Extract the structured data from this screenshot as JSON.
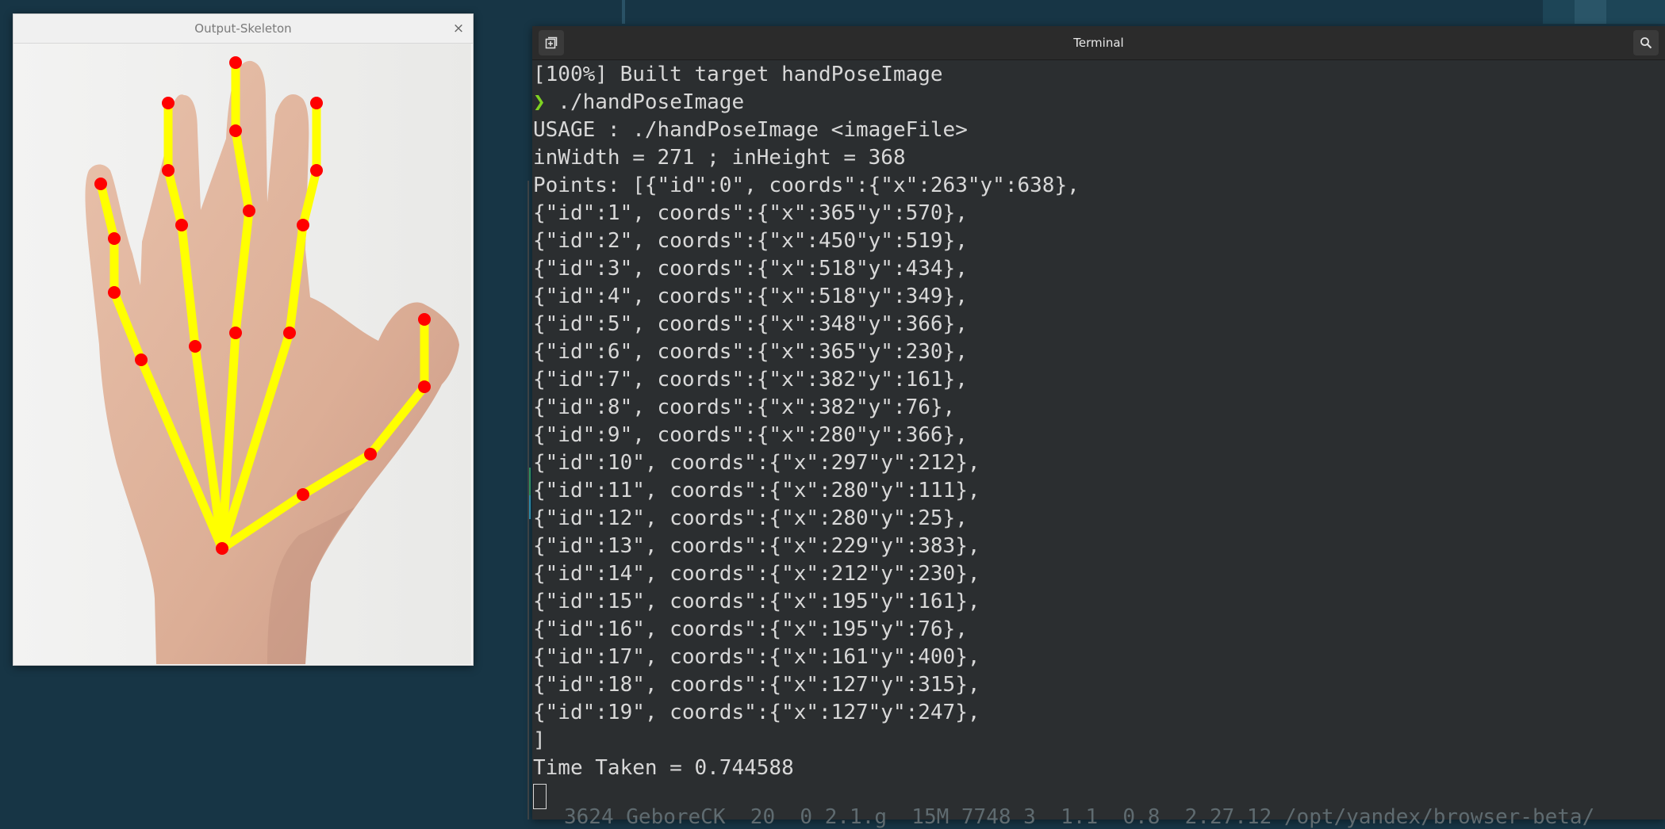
{
  "skeleton_window": {
    "title": "Output-Skeleton",
    "close_label": "×"
  },
  "terminal": {
    "title": "Terminal",
    "new_tab_icon": "new-tab-icon",
    "search_icon": "search-icon",
    "lines": [
      {
        "prompt": "",
        "text": "[100%] Built target handPoseImage"
      },
      {
        "prompt": "❯",
        "text": " ./handPoseImage"
      },
      {
        "prompt": "",
        "text": "USAGE : ./handPoseImage <imageFile>"
      },
      {
        "prompt": "",
        "text": "inWidth = 271 ; inHeight = 368"
      },
      {
        "prompt": "",
        "text": "Points: [{\"id\":0\", coords\":{\"x\":263\"y\":638},"
      },
      {
        "prompt": "",
        "text": "{\"id\":1\", coords\":{\"x\":365\"y\":570},"
      },
      {
        "prompt": "",
        "text": "{\"id\":2\", coords\":{\"x\":450\"y\":519},"
      },
      {
        "prompt": "",
        "text": "{\"id\":3\", coords\":{\"x\":518\"y\":434},"
      },
      {
        "prompt": "",
        "text": "{\"id\":4\", coords\":{\"x\":518\"y\":349},"
      },
      {
        "prompt": "",
        "text": "{\"id\":5\", coords\":{\"x\":348\"y\":366},"
      },
      {
        "prompt": "",
        "text": "{\"id\":6\", coords\":{\"x\":365\"y\":230},"
      },
      {
        "prompt": "",
        "text": "{\"id\":7\", coords\":{\"x\":382\"y\":161},"
      },
      {
        "prompt": "",
        "text": "{\"id\":8\", coords\":{\"x\":382\"y\":76},"
      },
      {
        "prompt": "",
        "text": "{\"id\":9\", coords\":{\"x\":280\"y\":366},"
      },
      {
        "prompt": "",
        "text": "{\"id\":10\", coords\":{\"x\":297\"y\":212},"
      },
      {
        "prompt": "",
        "text": "{\"id\":11\", coords\":{\"x\":280\"y\":111},"
      },
      {
        "prompt": "",
        "text": "{\"id\":12\", coords\":{\"x\":280\"y\":25},"
      },
      {
        "prompt": "",
        "text": "{\"id\":13\", coords\":{\"x\":229\"y\":383},"
      },
      {
        "prompt": "",
        "text": "{\"id\":14\", coords\":{\"x\":212\"y\":230},"
      },
      {
        "prompt": "",
        "text": "{\"id\":15\", coords\":{\"x\":195\"y\":161},"
      },
      {
        "prompt": "",
        "text": "{\"id\":16\", coords\":{\"x\":195\"y\":76},"
      },
      {
        "prompt": "",
        "text": "{\"id\":17\", coords\":{\"x\":161\"y\":400},"
      },
      {
        "prompt": "",
        "text": "{\"id\":18\", coords\":{\"x\":127\"y\":315},"
      },
      {
        "prompt": "",
        "text": "{\"id\":19\", coords\":{\"x\":127\"y\":247},"
      },
      {
        "prompt": "",
        "text": "]"
      },
      {
        "prompt": "",
        "text": "Time Taken = 0.744588"
      }
    ],
    "footer_text": "3624 GeboreCK  20  0 2.1.g  15M 7748 3  1.1  0.8  2.27.12 /opt/yandex/browser-beta/"
  },
  "colors": {
    "desktop": "#173545",
    "terminal_bg": "#2b2e30",
    "prompt": "#7ed321",
    "skeleton_line": "#ffff00",
    "keypoint": "#ff0000"
  }
}
